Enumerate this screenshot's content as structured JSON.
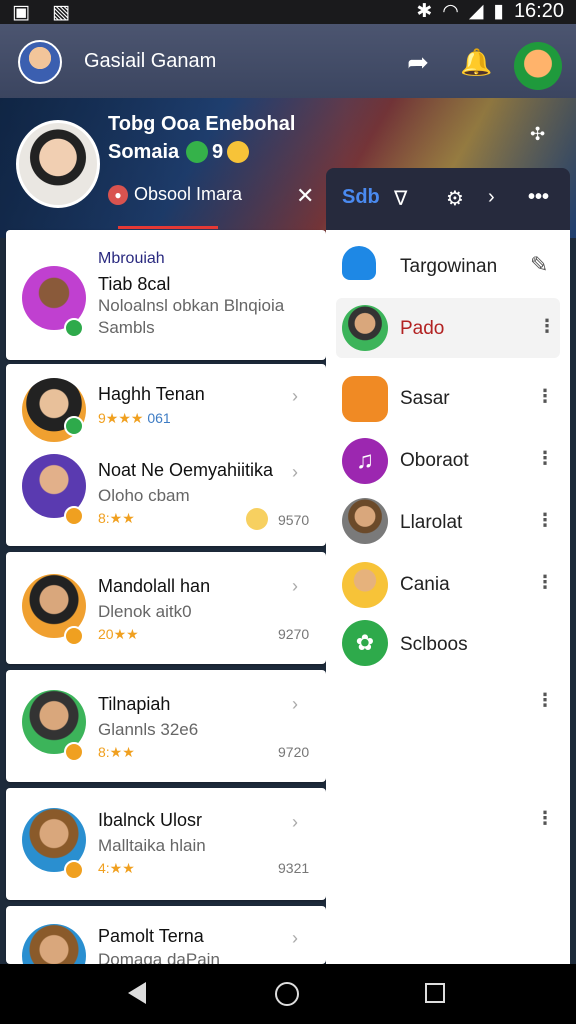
{
  "status_bar": {
    "time": "16:20"
  },
  "app_bar": {
    "title": "Gasiail Ganam"
  },
  "banner": {
    "title": "Tobg Ooa Enebohal",
    "subtitle": "Somaia",
    "badge_text": "9",
    "chip_label": "Obsool Imara",
    "close": "✕"
  },
  "list": [
    {
      "name": "Tiab 8cal",
      "header_tag": "Mbrouiah",
      "sub": "Noloalnsl obkan Blnqioia",
      "sub2": "Sambls",
      "rating": "",
      "price": ""
    },
    {
      "name": "Haghh Tenan",
      "sub": "",
      "rating": "9★★★",
      "rating_num": "061",
      "price": ""
    },
    {
      "name": "Noat Ne Oemyahiitika",
      "sub": "Oloho cbam",
      "rating": "8:★★",
      "price": "9570"
    },
    {
      "name": "Mandolall han",
      "sub": "Dlenok aitk0",
      "rating": "20★★",
      "price": "9270"
    },
    {
      "name": "Tilnapiah",
      "sub": "Glannls 32e6",
      "rating": "8:★★",
      "price": "9720"
    },
    {
      "name": "Ibalnck Ulosr",
      "sub": "Malltaika hlain",
      "rating": "4:★★",
      "price": "9321"
    },
    {
      "name": "Pamolt Terna",
      "sub": "Domaga daPain",
      "rating": "",
      "price": ""
    }
  ],
  "panel": {
    "header": {
      "label": "Sdb"
    },
    "rows": [
      {
        "label": "Targowinan"
      },
      {
        "label": "Pado"
      },
      {
        "label": "Sasar"
      },
      {
        "label": "Oboraot"
      },
      {
        "label": "Llarolat"
      },
      {
        "label": "Cania"
      },
      {
        "label": "Sclboos"
      }
    ]
  },
  "colors": {
    "accent": "#e53935",
    "panel_header": "#262a3d",
    "badge_green": "#2eaa4b",
    "badge_orange": "#f0a020"
  }
}
